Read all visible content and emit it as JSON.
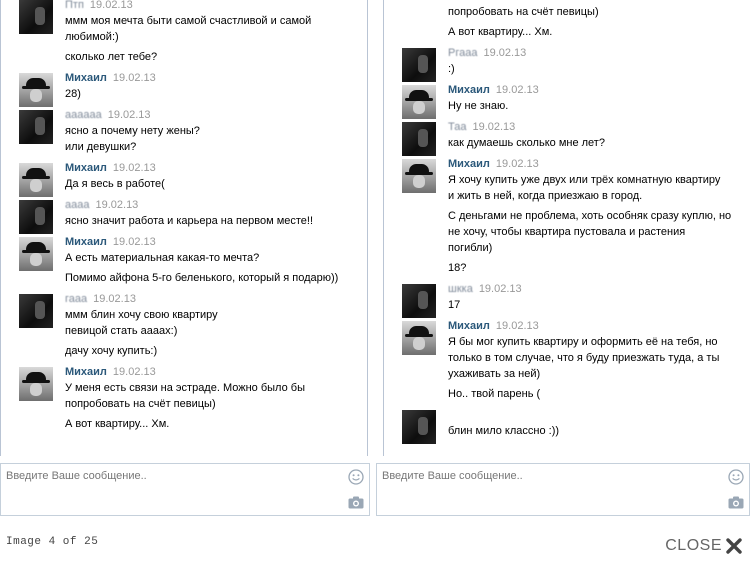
{
  "left_chat": {
    "messages": [
      {
        "author": "Птп",
        "author_blurred": true,
        "avatar": "dark",
        "date": "19.02.13",
        "paragraphs": [
          [
            "ммм моя мечта быти самой счастливой и самой",
            "любимой:)"
          ],
          [
            "сколько лет тебе?"
          ]
        ]
      },
      {
        "author": "Михаил",
        "author_blurred": false,
        "avatar": "hat",
        "date": "19.02.13",
        "paragraphs": [
          [
            "28)"
          ]
        ]
      },
      {
        "author": "аааааа",
        "author_blurred": true,
        "avatar": "dark",
        "date": "19.02.13",
        "paragraphs": [
          [
            "ясно а почему нету жены?",
            "или девушки?"
          ]
        ]
      },
      {
        "author": "Михаил",
        "author_blurred": false,
        "avatar": "hat",
        "date": "19.02.13",
        "paragraphs": [
          [
            "Да я весь в работе("
          ]
        ]
      },
      {
        "author": "аааа",
        "author_blurred": true,
        "avatar": "dark",
        "date": "19.02.13",
        "paragraphs": [
          [
            "ясно значит работа и карьера на первом месте!!"
          ]
        ]
      },
      {
        "author": "Михаил",
        "author_blurred": false,
        "avatar": "hat",
        "date": "19.02.13",
        "paragraphs": [
          [
            "А есть материальная какая-то мечта?"
          ],
          [
            "Помимо айфона 5-го беленького, который я подарю))"
          ]
        ]
      },
      {
        "author": "гааа",
        "author_blurred": true,
        "avatar": "dark",
        "date": "19.02.13",
        "paragraphs": [
          [
            "ммм блин хочу свою квартиру",
            "певицой стать аааах:)"
          ],
          [
            "дачу хочу купить:)"
          ]
        ]
      },
      {
        "author": "Михаил",
        "author_blurred": false,
        "avatar": "hat",
        "date": "19.02.13",
        "paragraphs": [
          [
            "У меня есть связи на эстраде. Можно было бы",
            "попробовать на счёт певицы)"
          ],
          [
            "А вот квартиру... Хм."
          ]
        ]
      }
    ],
    "composer_placeholder": "Введите Ваше сообщение.."
  },
  "right_chat": {
    "top_lines": [
      "попробовать на счёт певицы)",
      "А вот квартиру... Хм."
    ],
    "messages": [
      {
        "author": "Ргааа",
        "author_blurred": true,
        "avatar": "dark",
        "date": "19.02.13",
        "paragraphs": [
          [
            ":)"
          ]
        ]
      },
      {
        "author": "Михаил",
        "author_blurred": false,
        "avatar": "hat",
        "date": "19.02.13",
        "paragraphs": [
          [
            "Ну не знаю."
          ]
        ]
      },
      {
        "author": "Таа",
        "author_blurred": true,
        "avatar": "dark",
        "date": "19.02.13",
        "paragraphs": [
          [
            "как думаешь сколько мне лет?"
          ]
        ]
      },
      {
        "author": "Михаил",
        "author_blurred": false,
        "avatar": "hat",
        "date": "19.02.13",
        "paragraphs": [
          [
            "Я хочу купить уже двух или трёх комнатную квартиру",
            "и жить в ней, когда приезжаю в город."
          ],
          [
            "С деньгами не проблема, хоть особняк сразу куплю, но",
            "не хочу, чтобы квартира пустовала и растения",
            "погибли)"
          ],
          [
            "18?"
          ]
        ]
      },
      {
        "author": "шкка",
        "author_blurred": true,
        "avatar": "dark",
        "date": "19.02.13",
        "paragraphs": [
          [
            "17"
          ]
        ]
      },
      {
        "author": "Михаил",
        "author_blurred": false,
        "avatar": "hat",
        "date": "19.02.13",
        "paragraphs": [
          [
            "Я бы мог купить квартиру и оформить её на тебя, но",
            "только в том случае, что я буду приезжать туда, а ты",
            "ухаживать за ней)"
          ],
          [
            "Но.. твой парень ("
          ]
        ]
      },
      {
        "author": "",
        "author_blurred": true,
        "avatar": "dark",
        "date": "",
        "paragraphs": [
          [
            "блин мило классно :))"
          ]
        ]
      }
    ],
    "composer_placeholder": "Введите Ваше сообщение.."
  },
  "footer": {
    "image_counter": "Image 4 of 25",
    "close_label": "CLOSE"
  },
  "icons": {
    "smile": "smile-icon",
    "camera": "camera-icon",
    "close": "close-x-icon"
  },
  "colors": {
    "author_link": "#2b587a",
    "date_grey": "#999999",
    "border": "#c5d0db"
  }
}
